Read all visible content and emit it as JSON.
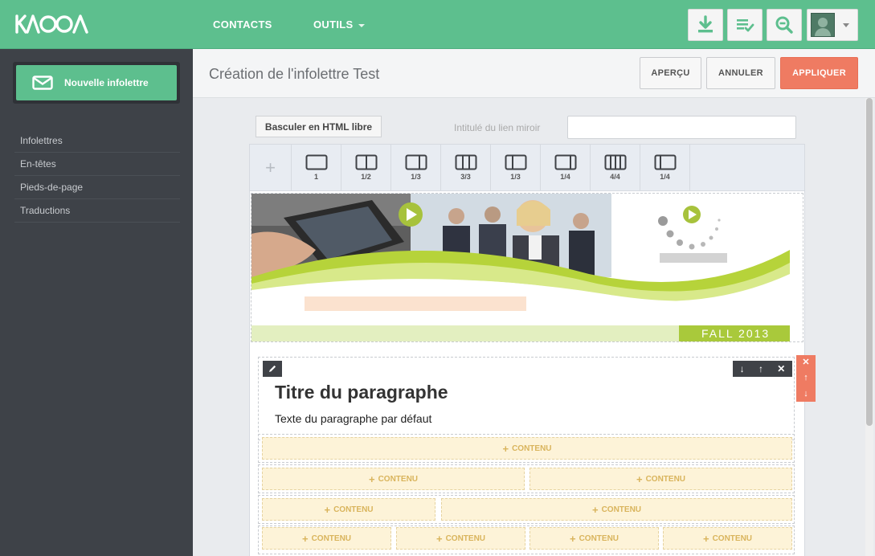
{
  "app": {
    "logo_text": "KAOOA"
  },
  "topnav": {
    "contacts": "CONTACTS",
    "outils": "OUTILS"
  },
  "sidebar": {
    "new_button": "Nouvelle infolettre",
    "items": [
      {
        "label": "Infolettres"
      },
      {
        "label": "En-têtes"
      },
      {
        "label": "Pieds-de-page"
      },
      {
        "label": "Traductions"
      }
    ]
  },
  "header": {
    "title": "Création de l'infolettre Test",
    "apercu": "APERÇU",
    "annuler": "ANNULER",
    "appliquer": "APPLIQUER"
  },
  "editor": {
    "toggle_html": "Basculer en HTML libre",
    "mirror_label": "Intitulé du lien miroir",
    "mirror_value": "",
    "layout_plus": "+",
    "layouts": [
      {
        "label": "1"
      },
      {
        "label": "1/2"
      },
      {
        "label": "1/3"
      },
      {
        "label": "3/3"
      },
      {
        "label": "1/3"
      },
      {
        "label": "1/4"
      },
      {
        "label": "4/4"
      },
      {
        "label": "1/4"
      }
    ],
    "banner_text": "FALL 2013",
    "paragraph": {
      "title": "Titre du paragraphe",
      "text": "Texte du paragraphe par défaut"
    },
    "content_label": "CONTENU"
  },
  "colors": {
    "primary": "#5dbf8e",
    "accent": "#ef7b62",
    "sidebar": "#3e4248"
  }
}
